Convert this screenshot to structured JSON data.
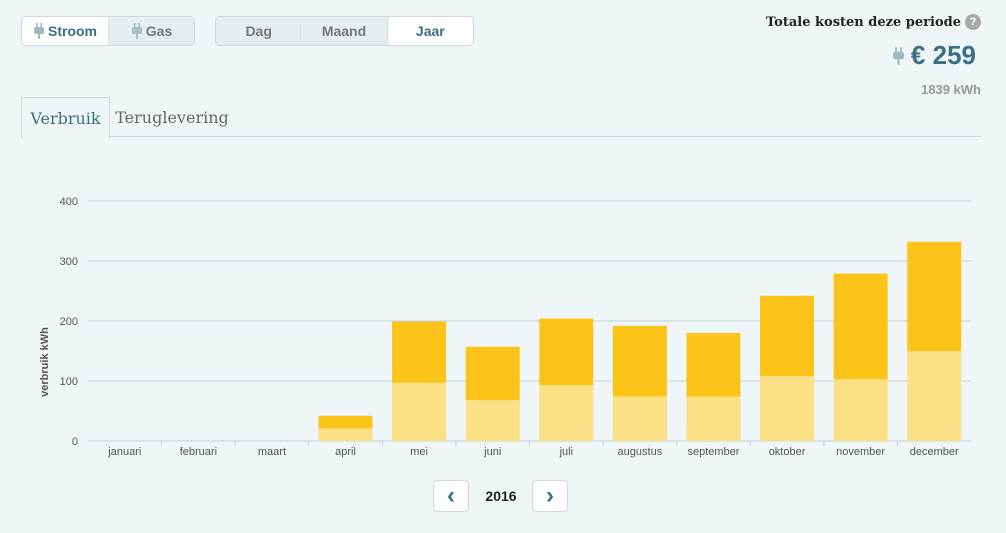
{
  "energy_toggle": {
    "stroom": "Stroom",
    "gas": "Gas"
  },
  "period_toggle": {
    "dag": "Dag",
    "maand": "Maand",
    "jaar": "Jaar"
  },
  "costs": {
    "title": "Totale kosten deze periode",
    "help": "?",
    "value": "€ 259",
    "kwh": "1839 kWh"
  },
  "tabs": {
    "verbruik": "Verbruik",
    "teruglevering": "Teruglevering"
  },
  "colors": {
    "dark": "#fcc419",
    "light": "#fce085",
    "accent": "#3b6e82"
  },
  "chart_data": {
    "type": "bar",
    "stacked": true,
    "ylabel": "verbruik kWh",
    "ylim": [
      0,
      400
    ],
    "yticks": [
      0,
      100,
      200,
      300,
      400
    ],
    "grid": true,
    "categories": [
      "januari",
      "februari",
      "maart",
      "april",
      "mei",
      "juni",
      "juli",
      "augustus",
      "september",
      "oktober",
      "november",
      "december"
    ],
    "series": [
      {
        "values": [
          0,
          0,
          0,
          21,
          97,
          68,
          93,
          74,
          74,
          108,
          103,
          150
        ]
      },
      {
        "values": [
          0,
          0,
          0,
          21,
          102,
          89,
          111,
          118,
          106,
          134,
          176,
          182
        ]
      }
    ]
  },
  "year_nav": {
    "year": "2016",
    "prev": "‹",
    "next": "›"
  }
}
